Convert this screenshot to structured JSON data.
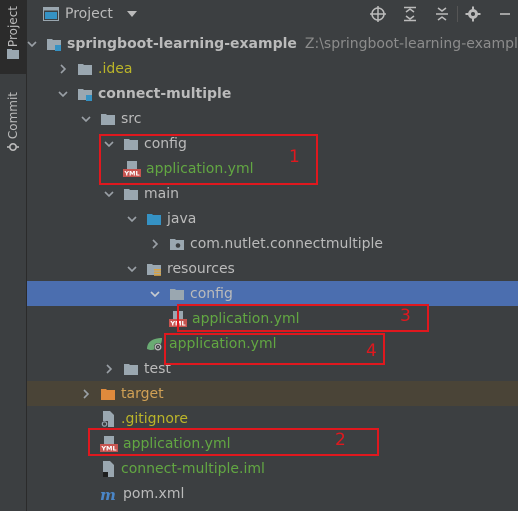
{
  "sidebar": {
    "project_tab": "Project",
    "commit_tab": "Commit"
  },
  "header": {
    "title": "Project"
  },
  "tree": [
    {
      "label": "springboot-learning-example",
      "path": "Z:\\springboot-learning-example",
      "icon": "module-folder-icon",
      "expanded": true
    },
    {
      "label": ".idea",
      "icon": "folder-icon",
      "expanded": false
    },
    {
      "label": "connect-multiple",
      "icon": "module-folder-icon",
      "expanded": true
    },
    {
      "label": "src",
      "icon": "folder-icon",
      "expanded": true
    },
    {
      "label": "config",
      "icon": "folder-icon",
      "expanded": true
    },
    {
      "label": "application.yml",
      "icon": "yml-file-icon"
    },
    {
      "label": "main",
      "icon": "folder-icon",
      "expanded": true
    },
    {
      "label": "java",
      "icon": "source-folder-icon",
      "expanded": true
    },
    {
      "label": "com.nutlet.connectmultiple",
      "icon": "package-icon",
      "expanded": false
    },
    {
      "label": "resources",
      "icon": "resources-folder-icon",
      "expanded": true
    },
    {
      "label": "config",
      "icon": "folder-icon",
      "expanded": true,
      "selected": true
    },
    {
      "label": "application.yml",
      "icon": "yml-file-icon"
    },
    {
      "label": "application.yml",
      "icon": "spring-yml-file-icon"
    },
    {
      "label": "test",
      "icon": "folder-icon",
      "expanded": false
    },
    {
      "label": "target",
      "icon": "excluded-folder-icon",
      "expanded": false
    },
    {
      "label": ".gitignore",
      "icon": "gitignore-file-icon"
    },
    {
      "label": "application.yml",
      "icon": "yml-file-icon"
    },
    {
      "label": "connect-multiple.iml",
      "icon": "iml-file-icon"
    },
    {
      "label": "pom.xml",
      "icon": "maven-file-icon"
    }
  ],
  "annotations": {
    "n1": "1",
    "n2": "2",
    "n3": "3",
    "n4": "4"
  },
  "colors": {
    "selection": "#4b6eaf",
    "annotation": "#e0181e",
    "vcs_new_file": "#62a742",
    "excluded": "#d0a055"
  }
}
